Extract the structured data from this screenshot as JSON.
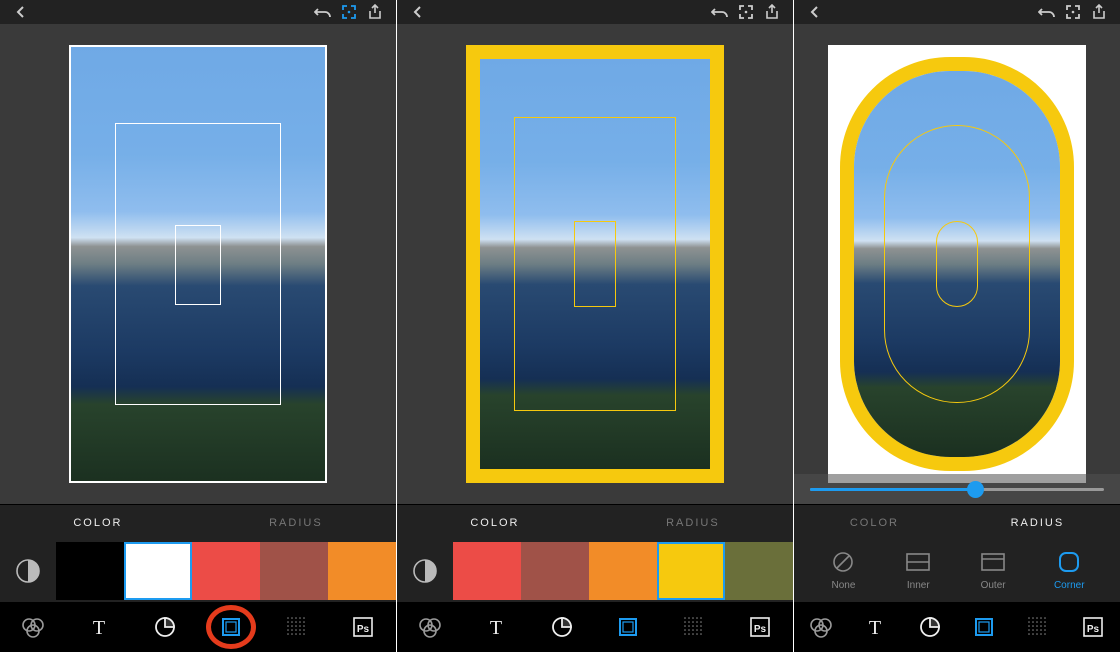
{
  "tabs": {
    "color": "COLOR",
    "radius": "RADIUS"
  },
  "radius_options": {
    "none": "None",
    "inner": "Inner",
    "outer": "Outer",
    "corner": "Corner"
  },
  "screen1": {
    "active_tab": "color",
    "swatches": [
      "#000000",
      "#ffffff",
      "#ec4c47",
      "#a05248",
      "#f28c28"
    ],
    "selected_swatch_index": 1,
    "bottom_active": "frame",
    "annotation_circle": true,
    "frame_color": "#ffffff",
    "frame_style": "outline"
  },
  "screen2": {
    "active_tab": "color",
    "swatches": [
      "#ec4c47",
      "#a05248",
      "#f28c28",
      "#f6c90e",
      "#6a6f3a"
    ],
    "selected_swatch_index": 3,
    "bottom_active": "frame",
    "frame_color": "#f6c90e",
    "frame_style": "thick"
  },
  "screen3": {
    "active_tab": "radius",
    "radius_active": "corner",
    "bottom_active": "frame",
    "slider_percent": 56,
    "frame_color": "#f6c90e",
    "frame_style": "rounded"
  }
}
